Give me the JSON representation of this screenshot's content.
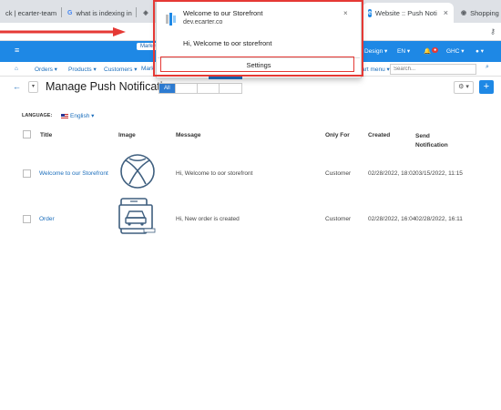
{
  "browser": {
    "tabs": [
      {
        "label": "ck | ecarter-team",
        "icon": "generic"
      },
      {
        "label": "what is indexing in",
        "icon": "google"
      },
      {
        "label": "",
        "icon": "drive"
      },
      {
        "label": "",
        "icon": "blank"
      },
      {
        "label": "Website :: Push Noti",
        "icon": "ecarter"
      },
      {
        "label": "Shopping Ca",
        "icon": "globe"
      }
    ],
    "key_icon": "key-icon"
  },
  "topbar": {
    "marketplace": "Marketplace s",
    "design": "Design ▾",
    "lang": "EN ▾",
    "currency": "GHC ▾",
    "user": "▾"
  },
  "nav": {
    "items": [
      "Orders ▾",
      "Products ▾",
      "Customers ▾",
      "Mark",
      "start menu ▾"
    ],
    "search_placeholder": "Search..."
  },
  "toolbar": {
    "title": "Manage Push Notification",
    "filter_tabs": [
      "All",
      "",
      "",
      ""
    ],
    "gear": "⚙ ▾",
    "plus": "+"
  },
  "content": {
    "language_label": "LANGUAGE:",
    "language_value": "English ▾",
    "columns": [
      "Title",
      "Image",
      "Message",
      "Only For",
      "Created",
      "Send Notification"
    ],
    "rows": [
      {
        "title": "Welcome to our Storefront",
        "image": "xbox-logo",
        "message": "Hi, Welcome to oor storefront",
        "only_for": "Customer",
        "created": "02/28/2022, 18:02",
        "sent": "03/15/2022, 11:15"
      },
      {
        "title": "Order",
        "image": "car-app",
        "message": "Hi, New order is created",
        "only_for": "Customer",
        "created": "02/28/2022, 16:04",
        "sent": "02/28/2022, 16:11"
      }
    ]
  },
  "popup": {
    "title": "Welcome to our Storefront",
    "domain": "dev.ecarter.co",
    "message": "Hi, Welcome to oor storefront",
    "settings": "Settings",
    "close": "×"
  },
  "colors": {
    "primary": "#1e88e5",
    "highlight": "#e53935",
    "link": "#1a6dbb"
  }
}
